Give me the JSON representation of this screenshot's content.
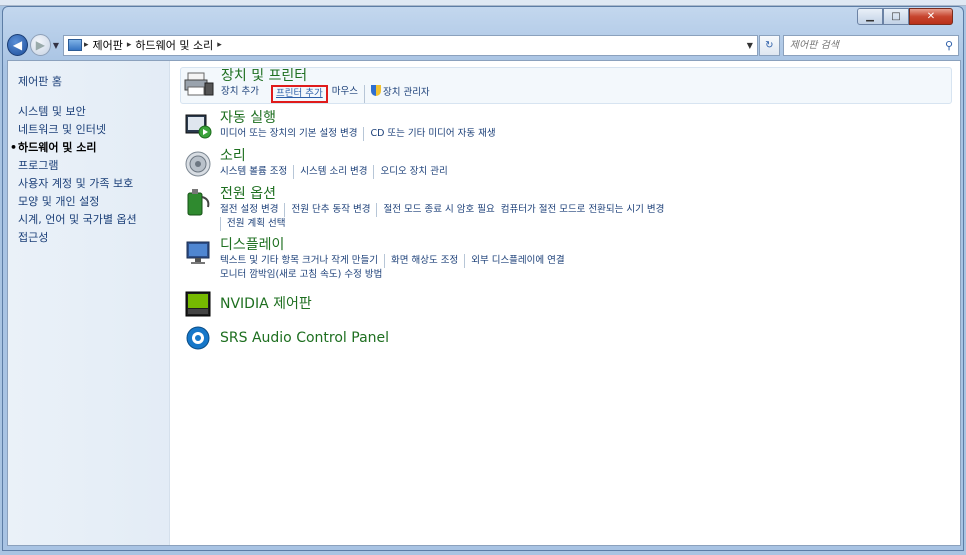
{
  "window": {
    "buttons": {
      "minimize": "▁",
      "maximize": "□",
      "close": "✕"
    }
  },
  "nav": {
    "back_icon": "arrow-left-icon",
    "forward_icon": "arrow-right-icon",
    "breadcrumb": [
      "제어판",
      "하드웨어 및 소리"
    ],
    "search_placeholder": "제어판 검색"
  },
  "sidebar": {
    "home": "제어판 홈",
    "items": [
      {
        "label": "시스템 및 보안",
        "active": false
      },
      {
        "label": "네트워크 및 인터넷",
        "active": false
      },
      {
        "label": "하드웨어 및 소리",
        "active": true
      },
      {
        "label": "프로그램",
        "active": false
      },
      {
        "label": "사용자 계정 및 가족 보호",
        "active": false
      },
      {
        "label": "모양 및 개인 설정",
        "active": false
      },
      {
        "label": "시계, 언어 및 국가별 옵션",
        "active": false
      },
      {
        "label": "접근성",
        "active": false
      }
    ]
  },
  "categories": [
    {
      "title": "장치 및 프린터",
      "icon": "printer-icon",
      "links": [
        "장치 추가",
        "프린터 추가",
        "마우스",
        "장치 관리자"
      ]
    },
    {
      "title": "자동 실행",
      "icon": "autoplay-icon",
      "links": [
        "미디어 또는 장치의 기본 설정 변경",
        "CD 또는 기타 미디어 자동 재생"
      ]
    },
    {
      "title": "소리",
      "icon": "speaker-icon",
      "links": [
        "시스템 볼륨 조정",
        "시스템 소리 변경",
        "오디오 장치 관리"
      ]
    },
    {
      "title": "전원 옵션",
      "icon": "power-icon",
      "links": [
        "절전 설정 변경",
        "전원 단추 동작 변경",
        "절전 모드 종료 시 암호 필요",
        "컴퓨터가 절전 모드로 전환되는 시기 변경",
        "전원 계획 선택"
      ]
    },
    {
      "title": "디스플레이",
      "icon": "display-icon",
      "links": [
        "텍스트 및 기타 항목 크거나 작게 만들기",
        "화면 해상도 조정",
        "외부 디스플레이에 연결",
        "모니터 깜박임(새로 고침 속도) 수정 방법"
      ]
    },
    {
      "title": "NVIDIA 제어판",
      "icon": "nvidia-icon",
      "links": []
    },
    {
      "title": "SRS Audio Control Panel",
      "icon": "srs-icon",
      "links": []
    }
  ]
}
